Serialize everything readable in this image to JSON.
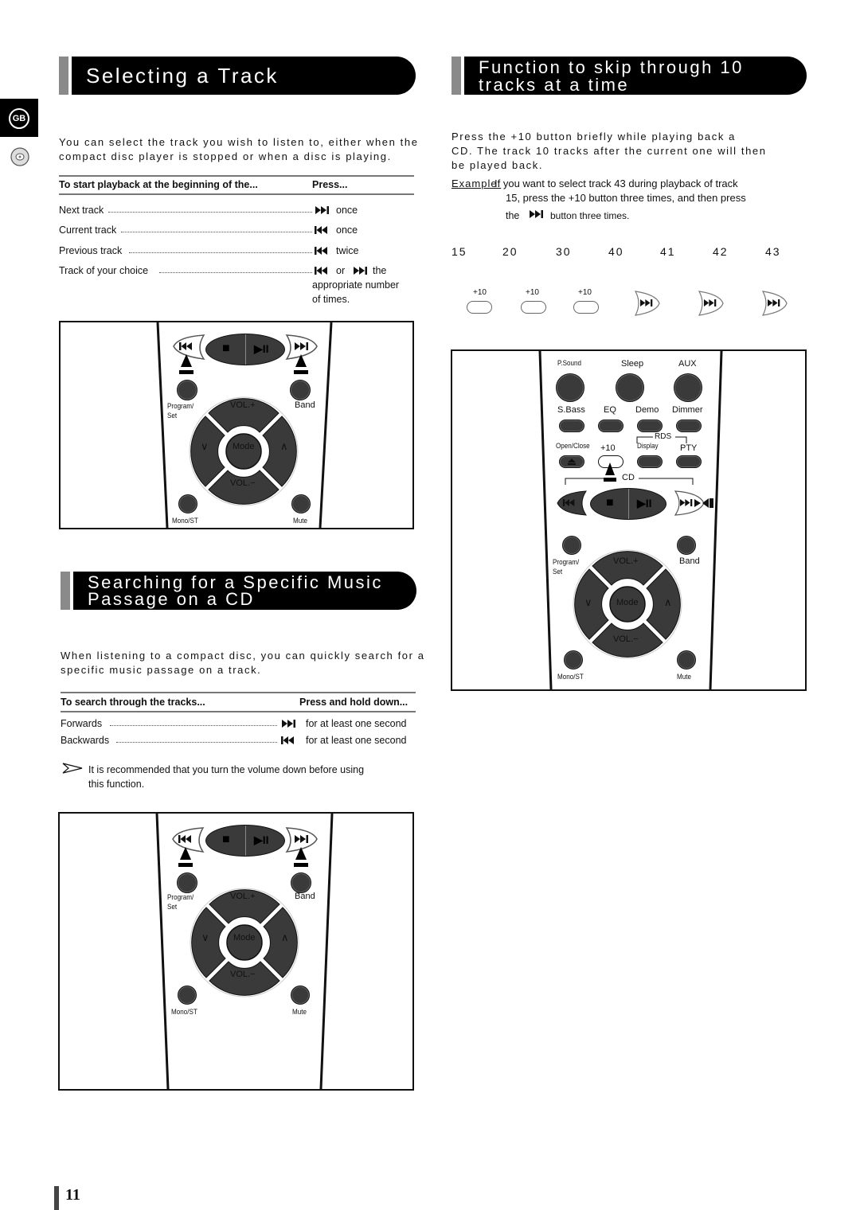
{
  "page": {
    "language_badge": "GB",
    "page_number": "11"
  },
  "selecting_track": {
    "title": "Selecting a Track",
    "intro_line1": "You can select the track you wish to listen to, either when the",
    "intro_line2": "compact disc player is stopped or when a disc is playing.",
    "table": {
      "col1_header": "To start playback at the beginning of the...",
      "col2_header": "Press...",
      "rows": [
        {
          "label": "Next track",
          "icon": "next-track-icon",
          "action": "once"
        },
        {
          "label": "Current track",
          "icon": "previous-track-icon",
          "action": "once"
        },
        {
          "label": "Previous track",
          "icon": "previous-track-icon",
          "action": "twice"
        },
        {
          "label": "Track of your choice",
          "icon": "previous-track-icon",
          "or_text": "or",
          "action": "the",
          "action_line2": "appropriate number",
          "action_line3": "of times."
        }
      ]
    }
  },
  "remote_common": {
    "program_set_1": "Program/",
    "program_set_2": "Set",
    "band": "Band",
    "vol_plus": "VOL.+",
    "vol_minus": "VOL.−",
    "mode": "Mode",
    "down": "∨",
    "up": "∧",
    "mono_st": "Mono/ST",
    "mute": "Mute",
    "stop_symbol": "■",
    "play_pause_symbol": "▶II"
  },
  "skip_ten": {
    "title_line1": "Function to skip through 10",
    "title_line2": "tracks at a time",
    "intro_line1": "Press the +10 button briefly while playing back a",
    "intro_line2": "CD. The track 10 tracks after the current one will then",
    "intro_line3": "be played back.",
    "example_label": "Example:",
    "example_line1": "If you want to select track 43 during playback of track",
    "example_line2": "15, press the  +10  button three times, and then press",
    "example_line3_pre": "the",
    "example_line3_post": "button three times.",
    "sequence": [
      "15",
      "20",
      "30",
      "40",
      "41",
      "42",
      "43"
    ],
    "steps": [
      {
        "type": "plus10",
        "label": "+10"
      },
      {
        "type": "plus10",
        "label": "+10"
      },
      {
        "type": "plus10",
        "label": "+10"
      },
      {
        "type": "next",
        "label": ""
      },
      {
        "type": "next",
        "label": ""
      },
      {
        "type": "next",
        "label": ""
      }
    ],
    "remote": {
      "p_sound": "P.Sound",
      "sleep": "Sleep",
      "aux": "AUX",
      "s_bass": "S.Bass",
      "eq": "EQ",
      "demo": "Demo",
      "dimmer": "Dimmer",
      "open_close": "Open/Close",
      "plus10": "+10",
      "display": "Display",
      "rds": "RDS",
      "pty": "PTY",
      "cd": "CD"
    }
  },
  "searching": {
    "title_line1": "Searching for a Specific Music",
    "title_line2": "Passage on a CD",
    "intro_line1": "When listening to a compact disc, you can quickly search for a",
    "intro_line2": "specific music passage on a track.",
    "table": {
      "col1_header": "To search through the tracks...",
      "col2_header": "Press and hold down...",
      "rows": [
        {
          "label": "Forwards",
          "icon": "next-track-icon",
          "action": "for at least one second"
        },
        {
          "label": "Backwards",
          "icon": "previous-track-icon",
          "action": "for at least one second"
        }
      ]
    },
    "note_line1": "It is recommended that you turn the volume down before using",
    "note_line2": "this function."
  }
}
